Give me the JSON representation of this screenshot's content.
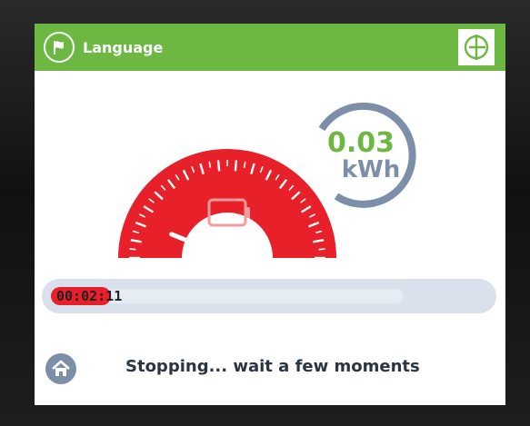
{
  "header": {
    "language_label": "Language",
    "background_color": "#6cb843",
    "language_icon": "flag-icon",
    "logo_icon": "brand-logo-icon"
  },
  "gauge": {
    "color": "#e8202a",
    "center_icon": "battery-icon",
    "needle_level": 0.05
  },
  "energy": {
    "value": "0.03",
    "unit": "kWh",
    "value_color": "#6cb843",
    "ring_color": "#7d8fa8"
  },
  "progress": {
    "elapsed_highlight": "00:02",
    "elapsed_rest": ":11",
    "fill_color": "#e8202a"
  },
  "footer": {
    "home_icon": "home-icon",
    "status_text": "Stopping... wait a few moments"
  }
}
